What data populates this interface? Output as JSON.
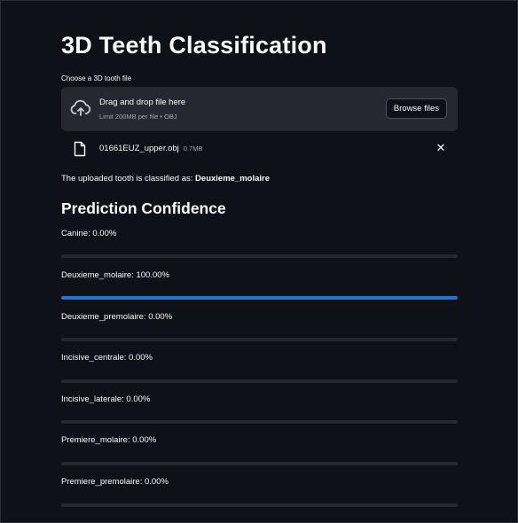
{
  "app": {
    "title": "3D Teeth Classification"
  },
  "uploader": {
    "label": "Choose a 3D tooth file",
    "drop_title": "Drag and drop file here",
    "drop_subtitle": "Limit 200MB per file • OBJ",
    "browse_label": "Browse files",
    "icon": "cloud-upload-icon"
  },
  "uploaded_file": {
    "name": "01661EUZ_upper.obj",
    "size": "0.7MB",
    "icon": "file-icon",
    "remove_icon": "close-icon"
  },
  "result": {
    "prefix": "The uploaded tooth is classified as: ",
    "class_name": "Deuxieme_molaire"
  },
  "confidence": {
    "heading": "Prediction Confidence",
    "items": [
      {
        "label": "Canine: 0.00%",
        "value": 0.0
      },
      {
        "label": "Deuxieme_molaire: 100.00%",
        "value": 1.0
      },
      {
        "label": "Deuxieme_premolaire: 0.00%",
        "value": 0.0
      },
      {
        "label": "Incisive_centrale: 0.00%",
        "value": 0.0
      },
      {
        "label": "Incisive_laterale: 0.00%",
        "value": 0.0
      },
      {
        "label": "Premiere_molaire: 0.00%",
        "value": 0.0
      },
      {
        "label": "Premiere_premolaire: 0.00%",
        "value": 0.0
      }
    ]
  },
  "colors": {
    "background": "#0e1117",
    "panel": "#262730",
    "progress": "#1f77d0",
    "text": "#fafafa",
    "muted_text": "#a3a8b8"
  }
}
